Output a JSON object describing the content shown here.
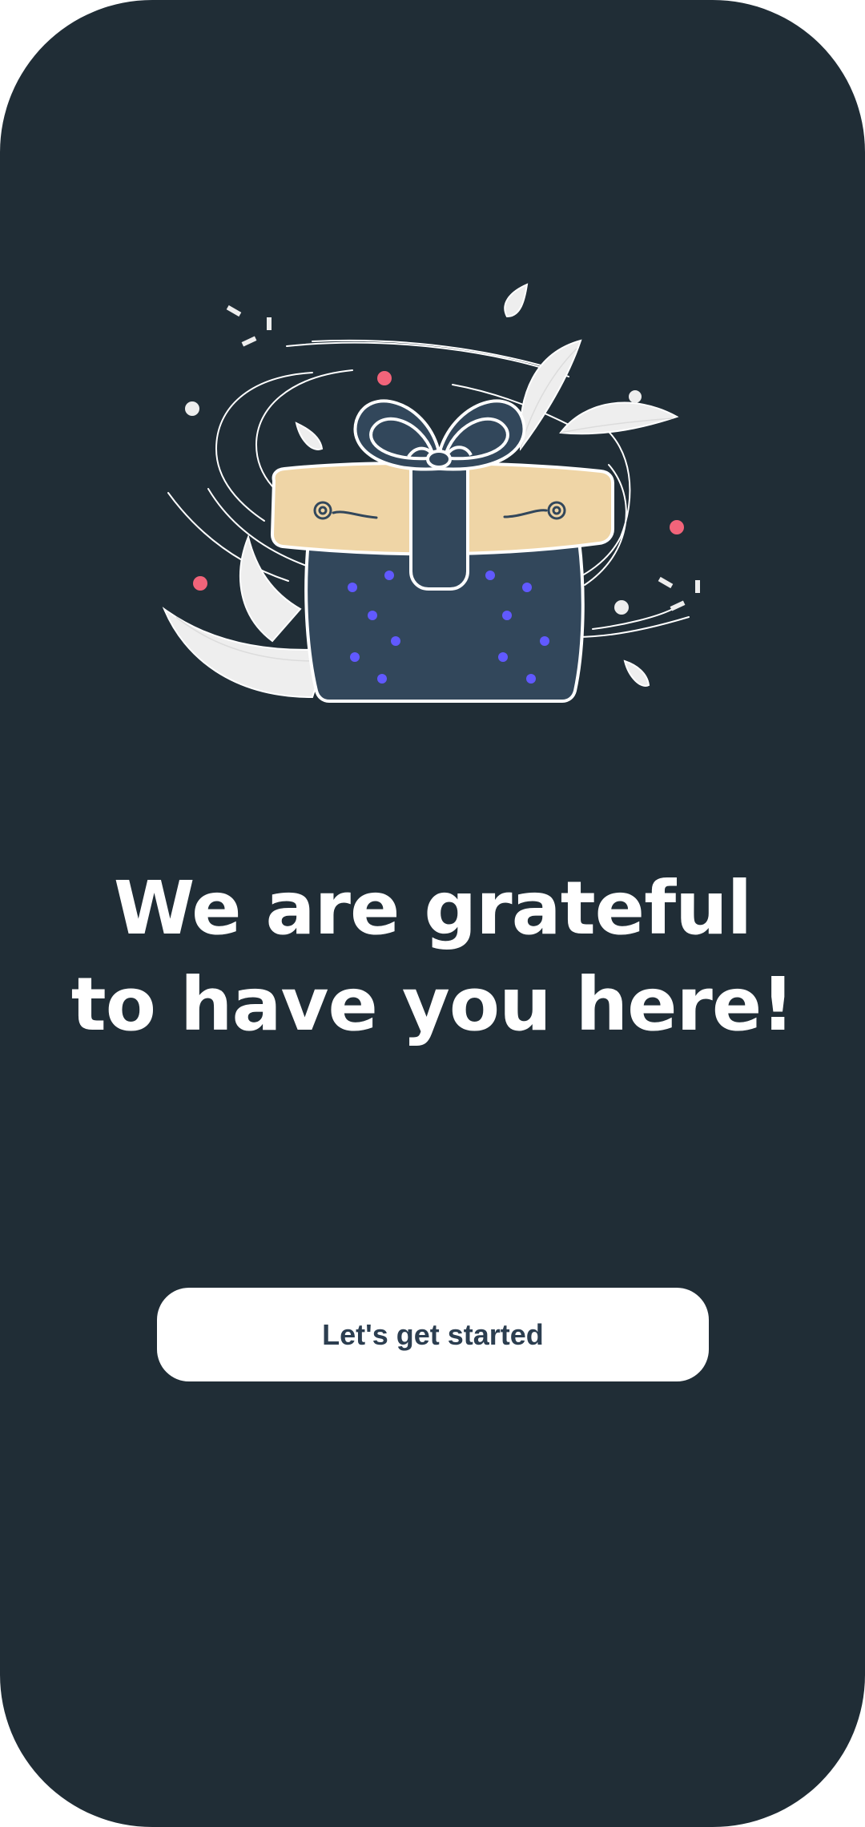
{
  "screen": {
    "background_color": "#202d36"
  },
  "illustration": {
    "name": "gift-box-illustration",
    "colors": {
      "box": "#32475b",
      "lid": "#efd5a6",
      "dots": "#6159ff",
      "accent_dots": "#f2647a",
      "leaves": "#eeeeee"
    }
  },
  "headline": {
    "line1": "We are grateful",
    "line2": "to have you here!"
  },
  "cta": {
    "label": "Let's get started"
  }
}
